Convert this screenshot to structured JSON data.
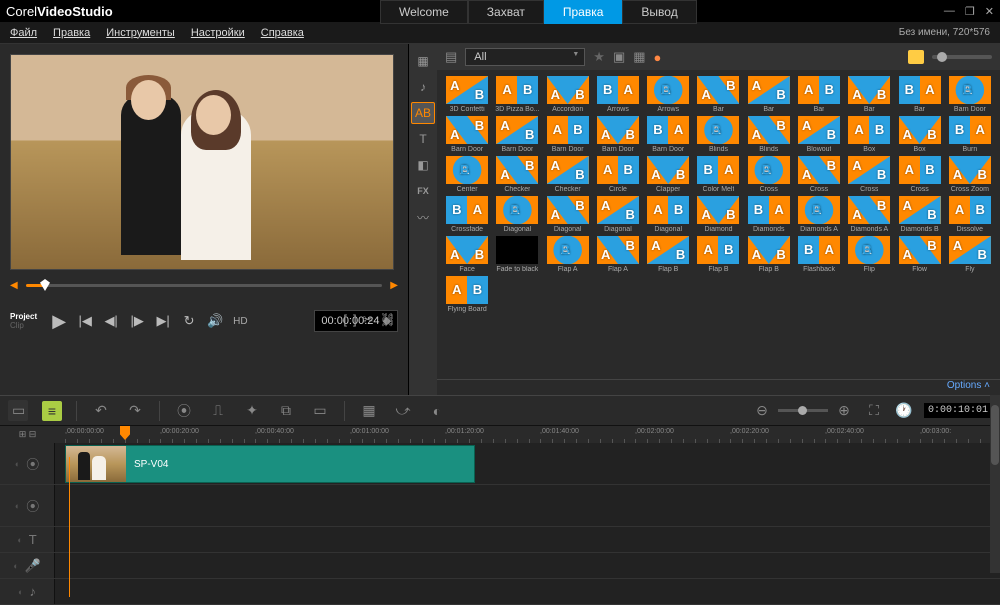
{
  "app": {
    "brand_light": "Corel",
    "brand_bold": "VideoStudio"
  },
  "top_tabs": {
    "welcome": "Welcome",
    "capture": "Захват",
    "edit": "Правка",
    "export": "Вывод"
  },
  "window_controls": {
    "min": "—",
    "max": "❐",
    "close": "✕"
  },
  "menu": {
    "file": "Файл",
    "edit": "Правка",
    "tools": "Инструменты",
    "settings": "Настройки",
    "help": "Справка"
  },
  "project_info": "Без имени, 720*576",
  "playback": {
    "mode_project": "Project",
    "mode_clip": "Clip",
    "hd": "HD",
    "timecode": "00:00:00:24",
    "spinner": "◆"
  },
  "edit_tools": {
    "markin": "[",
    "markout": "]",
    "cut": "✂",
    "link": "⛓"
  },
  "library": {
    "filter": "All",
    "options": "Options  ˄",
    "transitions": [
      "3D Confetti",
      "3D Pizza Bo...",
      "Accordion",
      "Arrows",
      "Arrows",
      "Bar",
      "Bar",
      "Bar",
      "Bar",
      "Bar",
      "Barn Door",
      "Barn Door",
      "Barn Door",
      "Barn Door",
      "Barn Door",
      "Barn Door",
      "Blinds",
      "Blinds",
      "Blowout",
      "Box",
      "Box",
      "Burn",
      "Center",
      "Checker",
      "Checker",
      "Circle",
      "Clapper",
      "Color Melt",
      "Cross",
      "Cross",
      "Cross",
      "Cross",
      "Cross Zoom",
      "Crossfade",
      "Diagonal",
      "Diagonal",
      "Diagonal",
      "Diagonal",
      "Diamond",
      "Diamonds",
      "Diamonds A",
      "Diamonds A",
      "Diamonds B",
      "Dissolve",
      "Face",
      "Fade to black",
      "Flap A",
      "Flap A",
      "Flap B",
      "Flap B",
      "Flap B",
      "Flashback",
      "Flip",
      "Flow",
      "Fly",
      "Flying Board"
    ]
  },
  "timeline": {
    "clip_name": "SP-V04",
    "duration_display": "0:00:10:01",
    "ruler_marks": [
      ",00:00:00:00",
      ",00:00:20:00",
      ",00:00:40:00",
      ",00:01:00:00",
      ",00:01:20:00",
      ",00:01:40:00",
      ",00:02:00:00",
      ",00:02:20:00",
      ",00:02:40:00",
      ",00:03:00:"
    ]
  }
}
